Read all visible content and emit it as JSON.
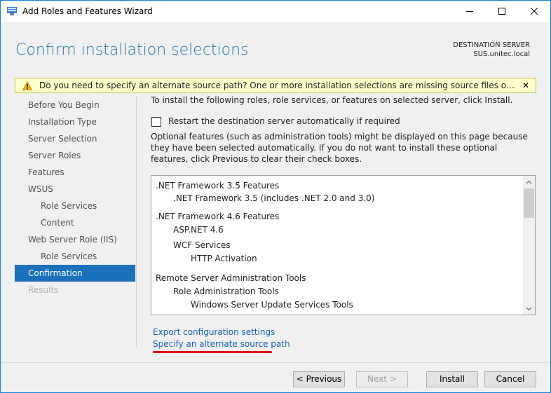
{
  "window": {
    "title": "Add Roles and Features Wizard"
  },
  "header": {
    "page_title": "Confirm installation selections",
    "destination_label": "DESTINATION SERVER",
    "destination_server": "SUS.unitec.local"
  },
  "warning": {
    "text": "Do you need to specify an alternate source path? One or more installation selections are missing source files on the destinati...",
    "close_label": "✕"
  },
  "nav": {
    "items": [
      {
        "label": "Before You Begin",
        "state": "normal",
        "level": 0
      },
      {
        "label": "Installation Type",
        "state": "normal",
        "level": 0
      },
      {
        "label": "Server Selection",
        "state": "normal",
        "level": 0
      },
      {
        "label": "Server Roles",
        "state": "normal",
        "level": 0
      },
      {
        "label": "Features",
        "state": "normal",
        "level": 0
      },
      {
        "label": "WSUS",
        "state": "normal",
        "level": 0
      },
      {
        "label": "Role Services",
        "state": "normal",
        "level": 1
      },
      {
        "label": "Content",
        "state": "normal",
        "level": 1
      },
      {
        "label": "Web Server Role (IIS)",
        "state": "normal",
        "level": 0
      },
      {
        "label": "Role Services",
        "state": "normal",
        "level": 1
      },
      {
        "label": "Confirmation",
        "state": "active",
        "level": 0
      },
      {
        "label": "Results",
        "state": "disabled",
        "level": 0
      }
    ]
  },
  "content": {
    "intro": "To install the following roles, role services, or features on selected server, click Install.",
    "restart_checkbox": {
      "label": "Restart the destination server automatically if required",
      "checked": false
    },
    "optional_text": "Optional features (such as administration tools) might be displayed on this page because they have been selected automatically. If you do not want to install these optional features, click Previous to clear their check boxes.",
    "selections": [
      {
        "label": ".NET Framework 3.5 Features",
        "level": 0
      },
      {
        "label": ".NET Framework 3.5 (includes .NET 2.0 and 3.0)",
        "level": 1
      },
      {
        "label": ".NET Framework 4.6 Features",
        "level": 0
      },
      {
        "label": "ASP.NET 4.6",
        "level": 1
      },
      {
        "label": "WCF Services",
        "level": 1
      },
      {
        "label": "HTTP Activation",
        "level": 2
      },
      {
        "label": "Remote Server Administration Tools",
        "level": 0
      },
      {
        "label": "Role Administration Tools",
        "level": 1
      },
      {
        "label": "Windows Server Update Services Tools",
        "level": 2
      }
    ],
    "links": {
      "export": "Export configuration settings",
      "alternate_source": "Specify an alternate source path"
    }
  },
  "footer": {
    "previous": "< Previous",
    "next": "Next >",
    "install": "Install",
    "cancel": "Cancel"
  },
  "colors": {
    "accent": "#1a70b9",
    "title_blue": "#1f6fa8",
    "link": "#1660b7",
    "warning_bg": "#ffffcc",
    "annotation_red": "#dd0000"
  }
}
